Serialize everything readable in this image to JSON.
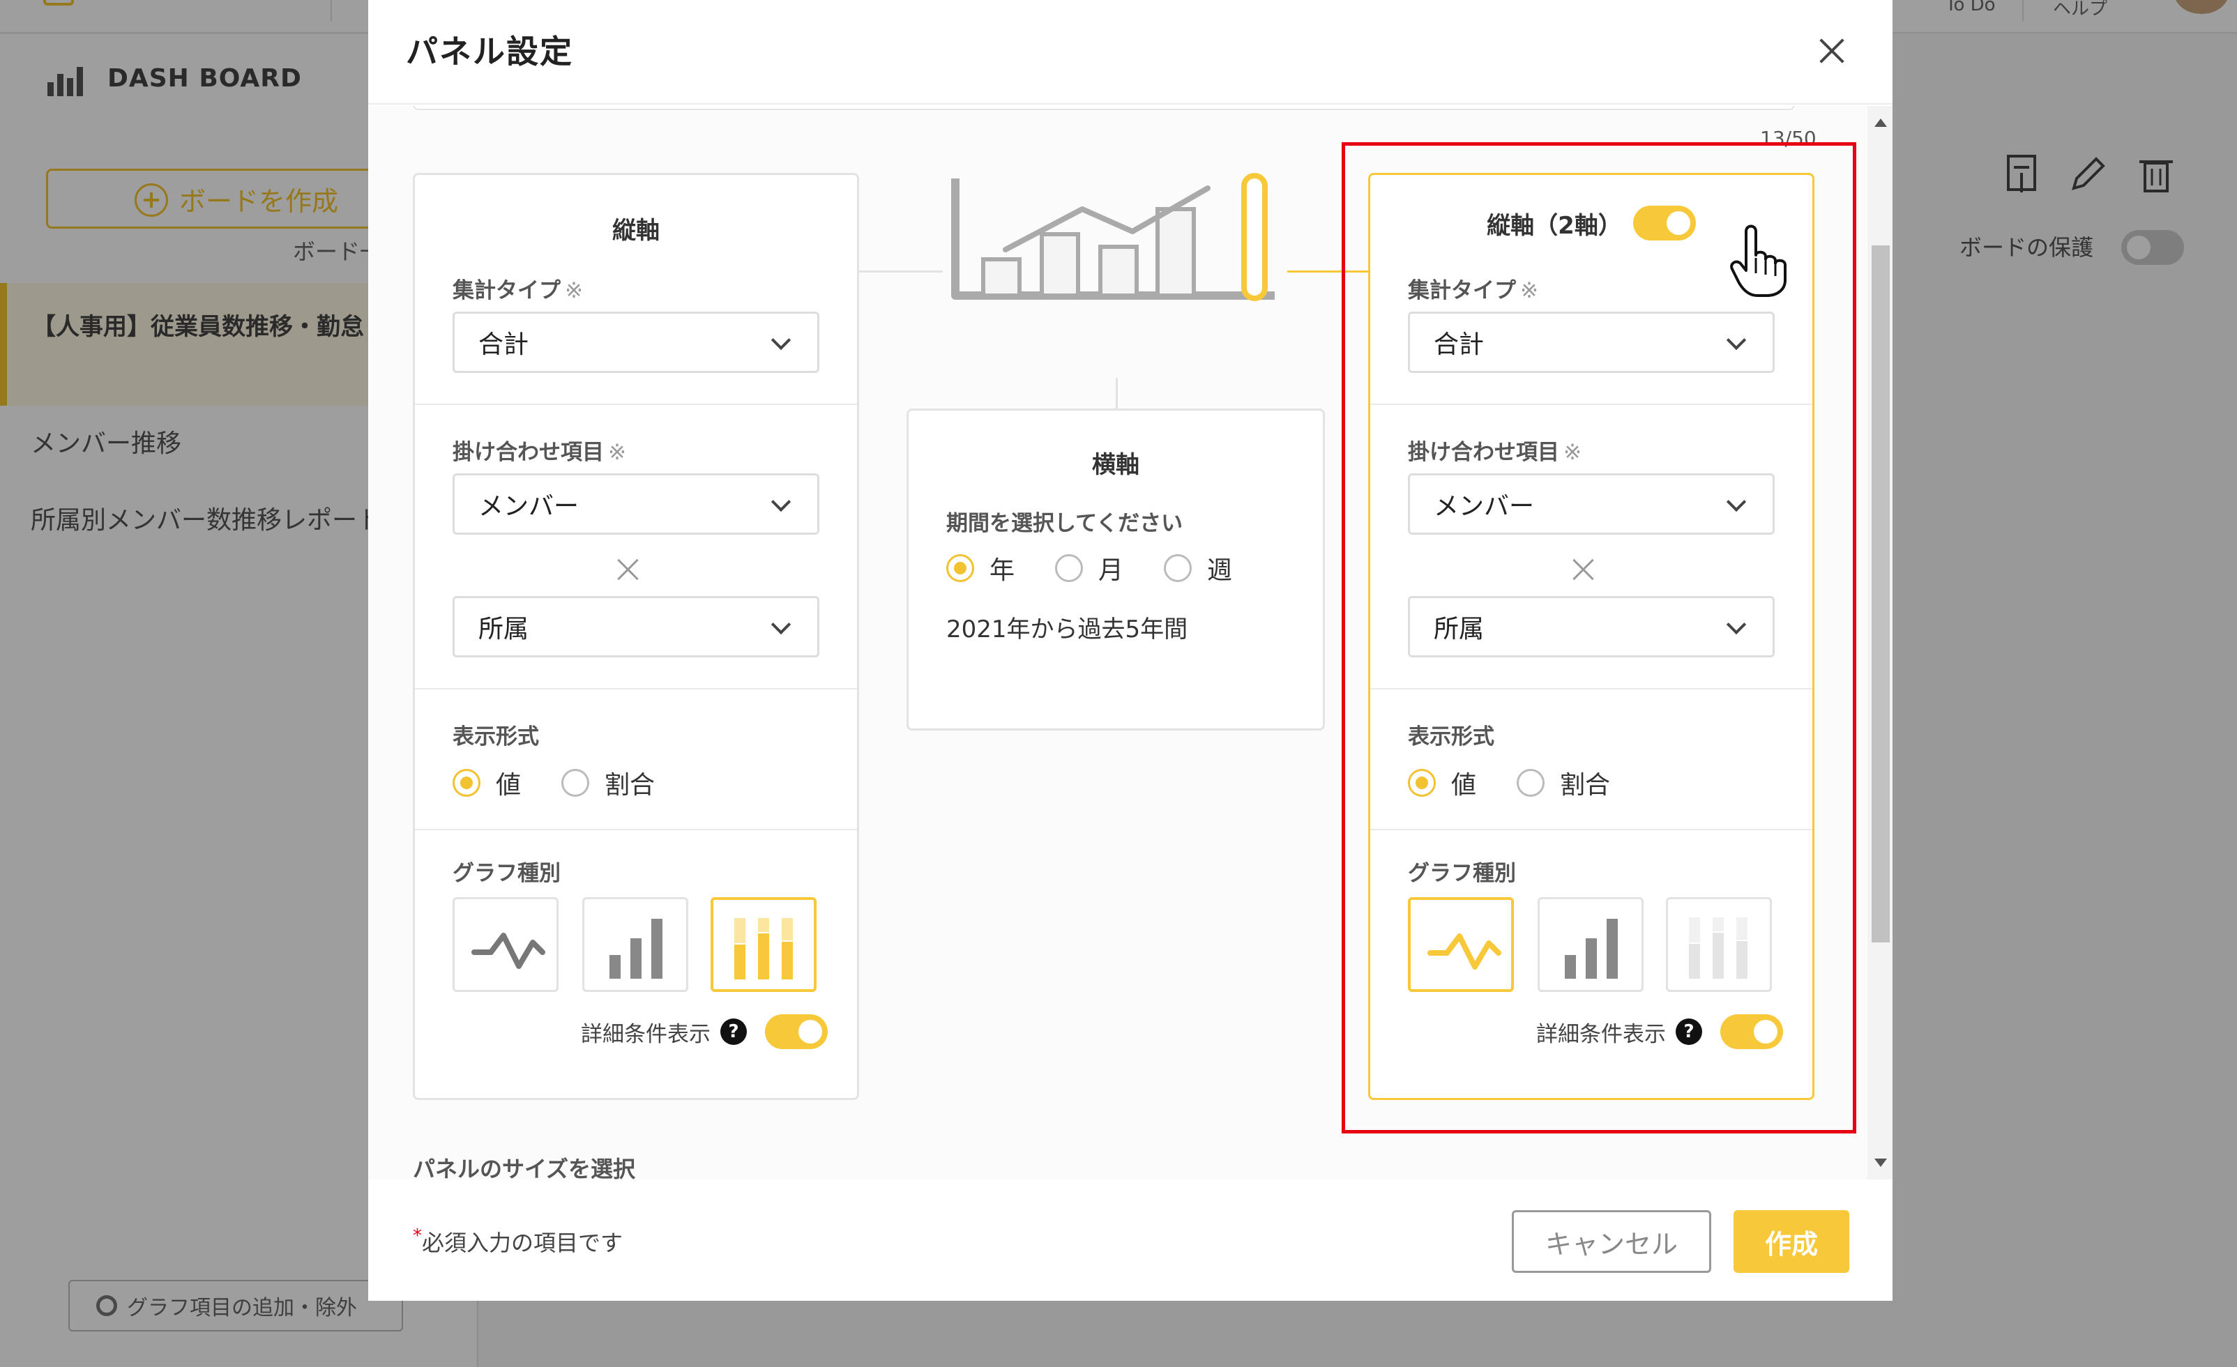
{
  "background": {
    "topbar": {
      "todo": "To Do",
      "help": "ヘルプ"
    },
    "sidebar": {
      "title": "DASH BOARD",
      "create_button": "ボードを作成",
      "board_label": "ボード一",
      "items": [
        {
          "label": "【人事用】従業員数推移・勤怠・有給"
        },
        {
          "label": "メンバー推移"
        },
        {
          "label": "所属別メンバー数推移レポート"
        }
      ],
      "bottom_button": "グラフ項目の追加・除外"
    },
    "main": {
      "protect_label": "ボードの保護"
    }
  },
  "modal": {
    "title": "パネル設定",
    "counter": "13/50",
    "left_axis": {
      "title": "縦軸",
      "agg_label": "集計タイプ",
      "req_mark": "※",
      "agg_value": "合計",
      "cross_label": "掛け合わせ項目",
      "cross_value1": "メンバー",
      "cross_value2": "所属",
      "display_label": "表示形式",
      "display_opt1": "値",
      "display_opt2": "割合",
      "graph_label": "グラフ種別",
      "detail_label": "詳細条件表示",
      "help": "?"
    },
    "x_axis": {
      "title": "横軸",
      "period_label": "期間を選択してください",
      "opt_year": "年",
      "opt_month": "月",
      "opt_week": "週",
      "range_text": "2021年から過去5年間"
    },
    "right_axis": {
      "title": "縦軸（2軸）",
      "agg_label": "集計タイプ",
      "req_mark": "※",
      "agg_value": "合計",
      "cross_label": "掛け合わせ項目",
      "cross_value1": "メンバー",
      "cross_value2": "所属",
      "display_label": "表示形式",
      "display_opt1": "値",
      "display_opt2": "割合",
      "graph_label": "グラフ種別",
      "detail_label": "詳細条件表示",
      "help": "?"
    },
    "size_label": "パネルのサイズを選択",
    "footer": {
      "required_mark": "*",
      "required_note": "必須入力の項目です",
      "cancel": "キャンセル",
      "create": "作成"
    }
  },
  "colors": {
    "accent": "#f7c93a",
    "highlight": "#e60012"
  }
}
